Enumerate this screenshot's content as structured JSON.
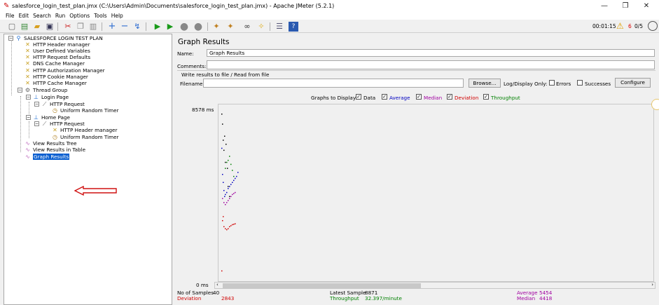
{
  "window": {
    "title": "salesforce_login_test_plan.jmx (C:\\Users\\Admin\\Documents\\salesforce_login_test_plan.jmx) - Apache JMeter (5.2.1)"
  },
  "menu": [
    "File",
    "Edit",
    "Search",
    "Run",
    "Options",
    "Tools",
    "Help"
  ],
  "toolbar": {
    "elapsed": "00:01:15",
    "warnings": "6",
    "threads": "0/5"
  },
  "tree": {
    "root": "SALESFORCE LOGIN TEST PLAN",
    "items": [
      "HTTP Header manager",
      "User Defined Variables",
      "HTTP Request Defaults",
      "DNS Cache Manager",
      "HTTP Authorization Manager",
      "HTTP Cookie Manager",
      "HTTP Cache Manager",
      "Thread Group",
      "Login Page",
      "HTTP Request",
      "Uniform Random Timer",
      "Home Page",
      "HTTP Request",
      "HTTP Header manager",
      "Uniform Random Timer",
      "View Results Tree",
      "View Results in Table",
      "Graph Results"
    ]
  },
  "panel": {
    "title": "Graph Results",
    "name_label": "Name:",
    "name_value": "Graph Results",
    "comments_label": "Comments:",
    "file_section": "Write results to file / Read from file",
    "filename_label": "Filename",
    "browse_label": "Browse...",
    "logdisplay_label": "Log/Display Only:",
    "errors_label": "Errors",
    "successes_label": "Successes",
    "configure_label": "Configure",
    "graphs_label": "Graphs to Display",
    "toggles": [
      {
        "label": "Data",
        "color": "#000000"
      },
      {
        "label": "Average",
        "color": "#0000c0"
      },
      {
        "label": "Median",
        "color": "#a000a0"
      },
      {
        "label": "Deviation",
        "color": "#d00000"
      },
      {
        "label": "Throughput",
        "color": "#008000"
      }
    ]
  },
  "stats": {
    "samples_label": "No of Samples",
    "samples_value": "40",
    "deviation_label": "Deviation",
    "deviation_value": "2843",
    "latest_label": "Latest Sample",
    "latest_value": "8871",
    "throughput_label": "Throughput",
    "throughput_value": "32.397/minute",
    "average_label": "Average",
    "average_value": "5454",
    "median_label": "Median",
    "median_value": "4418"
  },
  "chart_data": {
    "type": "scatter",
    "ytop_label": "8578  ms",
    "ybottom_label": "0  ms",
    "ylim": [
      0,
      8578
    ],
    "series": [
      {
        "name": "Data",
        "color": "#000000",
        "points": [
          [
            1,
            8300
          ],
          [
            2,
            7800
          ],
          [
            3,
            7000
          ],
          [
            4,
            6500
          ],
          [
            5,
            7200
          ],
          [
            6,
            5900
          ],
          [
            7,
            6800
          ],
          [
            9,
            5600
          ],
          [
            10,
            4700
          ],
          [
            12,
            4200
          ]
        ]
      },
      {
        "name": "Average",
        "color": "#0000c0",
        "points": [
          [
            1,
            6600
          ],
          [
            2,
            5300
          ],
          [
            3,
            4900
          ],
          [
            4,
            4500
          ],
          [
            5,
            4200
          ],
          [
            6,
            4300
          ],
          [
            8,
            4400
          ],
          [
            10,
            4600
          ],
          [
            12,
            4700
          ],
          [
            14,
            4800
          ],
          [
            16,
            4900
          ],
          [
            18,
            5000
          ],
          [
            20,
            5100
          ],
          [
            22,
            5200
          ],
          [
            24,
            5400
          ]
        ]
      },
      {
        "name": "Median",
        "color": "#a000a0",
        "points": [
          [
            2,
            4100
          ],
          [
            4,
            3900
          ],
          [
            6,
            3800
          ],
          [
            8,
            3900
          ],
          [
            10,
            4000
          ],
          [
            12,
            4100
          ],
          [
            14,
            4200
          ],
          [
            16,
            4300
          ],
          [
            18,
            4350
          ],
          [
            20,
            4400
          ]
        ]
      },
      {
        "name": "Deviation",
        "color": "#d00000",
        "points": [
          [
            1,
            500
          ],
          [
            2,
            3000
          ],
          [
            3,
            3200
          ],
          [
            4,
            2700
          ],
          [
            6,
            2600
          ],
          [
            8,
            2550
          ],
          [
            10,
            2600
          ],
          [
            12,
            2700
          ],
          [
            14,
            2750
          ],
          [
            16,
            2800
          ],
          [
            18,
            2820
          ],
          [
            20,
            2843
          ]
        ]
      },
      {
        "name": "Throughput",
        "color": "#008000",
        "points": [
          [
            6,
            5600
          ],
          [
            8,
            5900
          ],
          [
            10,
            6000
          ],
          [
            12,
            6200
          ],
          [
            14,
            5800
          ],
          [
            16,
            5500
          ],
          [
            18,
            5200
          ]
        ]
      }
    ]
  }
}
